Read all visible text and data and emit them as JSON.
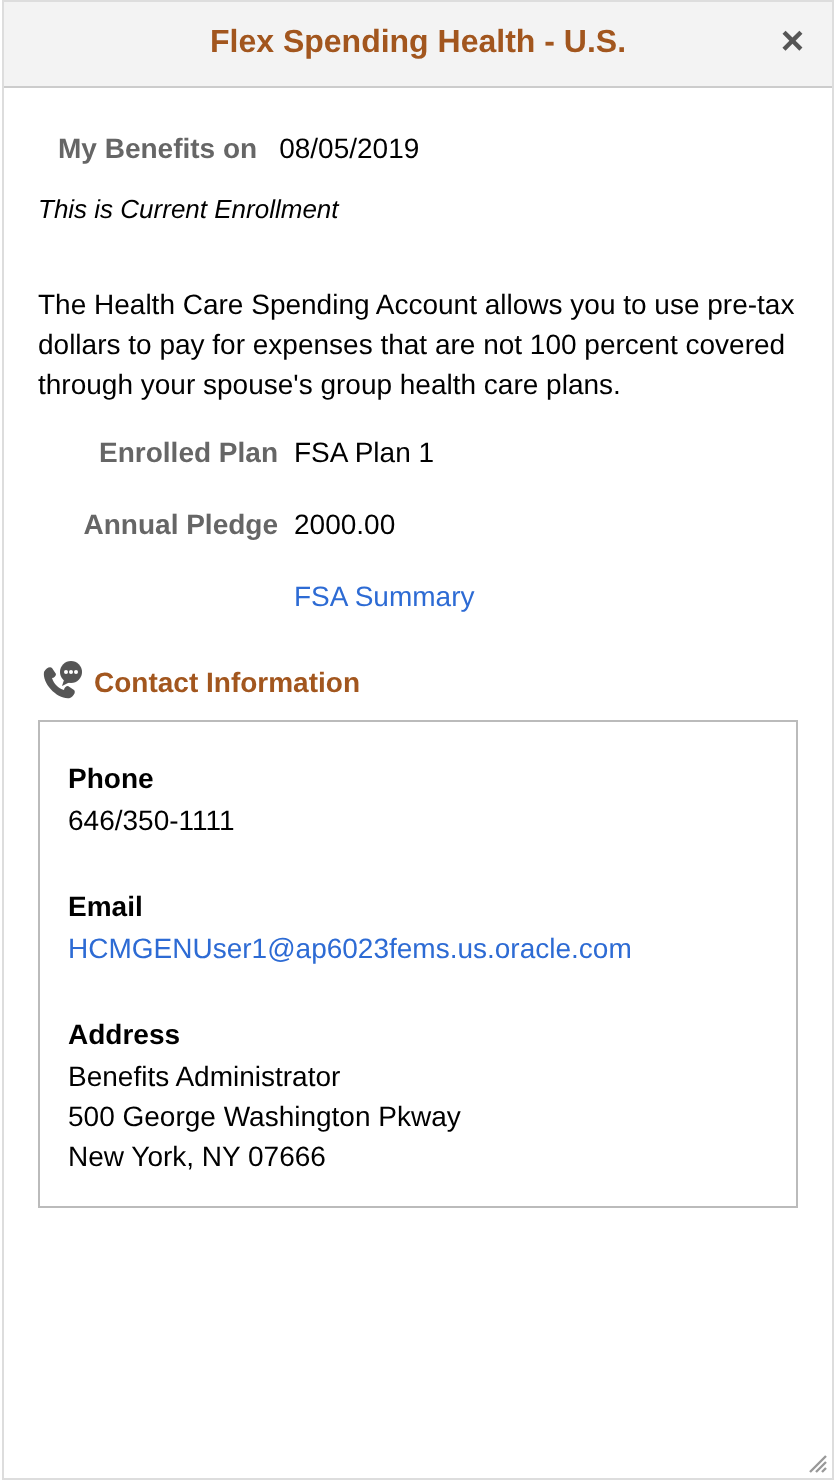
{
  "window": {
    "title": "Flex Spending Health - U.S.",
    "close": "×"
  },
  "benefits_date": {
    "label": "My Benefits on",
    "value": "08/05/2019"
  },
  "enrollment_note": "This is Current Enrollment",
  "description": "The Health Care Spending Account allows you to use pre-tax dollars to pay for expenses that are not 100 percent covered through your spouse's group health care plans.",
  "fields": [
    {
      "label": "Enrolled Plan",
      "value": "FSA Plan 1"
    },
    {
      "label": "Annual Pledge",
      "value": "2000.00"
    }
  ],
  "summary_link": "FSA Summary",
  "contact": {
    "title": "Contact Information",
    "sections": [
      {
        "heading": "Phone",
        "lines": [
          {
            "text": "646/350-1111",
            "kind": "text"
          }
        ]
      },
      {
        "heading": "Email",
        "lines": [
          {
            "text": "HCMGENUser1@ap6023fems.us.oracle.com",
            "kind": "link"
          }
        ]
      },
      {
        "heading": "Address",
        "lines": [
          {
            "text": "Benefits Administrator",
            "kind": "text"
          },
          {
            "text": "500 George Washington Pkway",
            "kind": "text"
          },
          {
            "text": "New York, NY 07666",
            "kind": "text"
          }
        ]
      }
    ]
  }
}
